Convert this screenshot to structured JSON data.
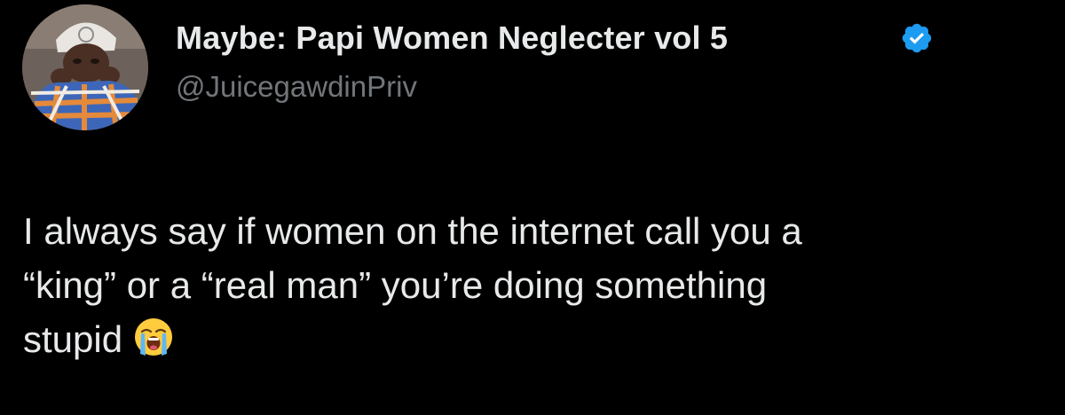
{
  "tweet": {
    "author": {
      "display_name": "Maybe: Papi Women Neglecter vol 5",
      "handle": "@JuicegawdinPriv",
      "verified": true,
      "verified_icon": "verified-badge-icon",
      "avatar": "profile-photo"
    },
    "text_lines": [
      "I always say if women on the internet call you a",
      "“king” or a “real man” you’re doing something",
      "stupid"
    ],
    "emoji": "loudly-crying-face-emoji"
  },
  "colors": {
    "background": "#000000",
    "text_primary": "#e7e9ea",
    "text_secondary": "#71767b",
    "verified_blue": "#1d9bf0"
  }
}
